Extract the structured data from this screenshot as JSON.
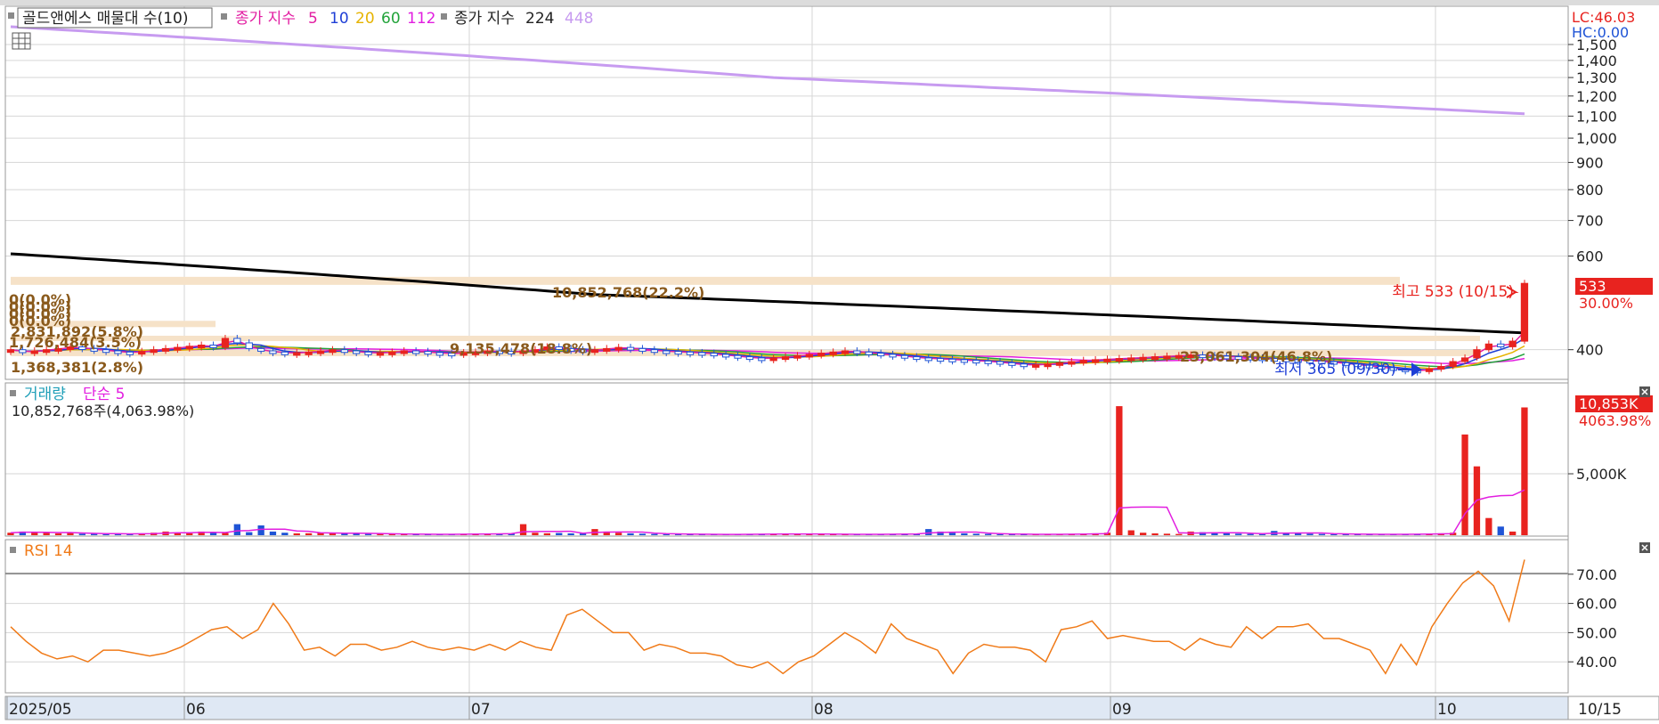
{
  "colors": {
    "up": "#e8231f",
    "down": "#1f54d6",
    "ma5": "#e21ea2",
    "ma10": "#1f3fd6",
    "ma20": "#e6b300",
    "ma60": "#22a33a",
    "ma112": "#e21ee0",
    "ma224": "#000000",
    "ma448": "#c79bf0",
    "vol_ma": "#e21ee0",
    "rsi": "#f07a18",
    "profile_text": "#8a5a1c",
    "profile_bar": "#f6e2c8",
    "grid": "#d6d6d6",
    "axis_bg": "#dfe8f4"
  },
  "legend": {
    "title": "골드앤에스 매물대 수(10)",
    "ma_label": "종가 지수",
    "ma_periods": [
      "5",
      "10",
      "20",
      "60",
      "112"
    ],
    "ma2_label": "종가 지수",
    "ma2_periods": [
      "224",
      "448"
    ],
    "volume_label": "거래량",
    "volume_ma_label": "단순 5",
    "volume_value": "10,852,768주(4,063.98%)",
    "rsi_label": "RSI 14"
  },
  "price_panel": {
    "lc": "LC:46.03",
    "hc": "HC:0.00",
    "high_label": "최고 533 (10/15)",
    "low_label": "최저 365 (09/30)",
    "last_price": "533",
    "last_change": "30.00%",
    "ticks": [
      "1,500",
      "1,400",
      "1,300",
      "1,200",
      "1,100",
      "1,000",
      "900",
      "800",
      "700",
      "600",
      "400"
    ],
    "profile_labels": [
      "10,852,768(22.2%)",
      "0(0.0%)",
      "0(0.0%)",
      "0(0.0%)",
      "0(0.0%)",
      "2,831,892(5.8%)",
      "1,726,484(3.5%)",
      "9,135,478(18.8%)",
      "23,061,304(46.8%)",
      "1,368,381(2.8%)"
    ]
  },
  "volume_panel": {
    "last_value": "10,853K",
    "last_pct": "4063.98%",
    "ticks": [
      "5,000K"
    ]
  },
  "rsi_panel": {
    "ticks": [
      "70.00",
      "60.00",
      "50.00",
      "40.00"
    ]
  },
  "x_axis": {
    "labels": [
      "2025/05",
      "06",
      "07",
      "08",
      "09",
      "10"
    ],
    "current": "10/15"
  },
  "chart_data": {
    "type": "line",
    "title": "골드앤에스 매물대 수(10)",
    "ylim": [
      360,
      1500
    ],
    "y_scale": "log",
    "price": [
      400,
      395,
      398,
      400,
      402,
      405,
      402,
      400,
      398,
      396,
      395,
      397,
      400,
      402,
      404,
      406,
      408,
      404,
      420,
      412,
      402,
      398,
      396,
      394,
      395,
      396,
      398,
      400,
      398,
      396,
      394,
      395,
      396,
      398,
      397,
      395,
      394,
      393,
      395,
      396,
      398,
      397,
      396,
      398,
      400,
      405,
      402,
      400,
      398,
      400,
      402,
      404,
      402,
      400,
      398,
      397,
      396,
      395,
      394,
      392,
      390,
      388,
      386,
      385,
      386,
      388,
      390,
      392,
      394,
      396,
      398,
      396,
      394,
      392,
      390,
      388,
      386,
      385,
      384,
      383,
      382,
      381,
      380,
      378,
      376,
      374,
      375,
      376,
      378,
      380,
      382,
      383,
      384,
      385,
      386,
      387,
      388,
      389,
      390,
      391,
      390,
      389,
      388,
      387,
      386,
      385,
      384,
      383,
      382,
      381,
      380,
      378,
      376,
      374,
      372,
      370,
      368,
      366,
      365,
      368,
      372,
      380,
      386,
      400,
      410,
      405,
      415,
      533
    ],
    "ma224": [
      606,
      604,
      602,
      600,
      598,
      596,
      594,
      592,
      590,
      588,
      586,
      584,
      582,
      580,
      578,
      576,
      574,
      572,
      570,
      568,
      566,
      564,
      562,
      560,
      558,
      556,
      554,
      552,
      550,
      548,
      546,
      544,
      542,
      540,
      538,
      536,
      534,
      532,
      530,
      528,
      526,
      524,
      522,
      520,
      518,
      516,
      514,
      512,
      510,
      508,
      507,
      506,
      505,
      504,
      503,
      502,
      501,
      500,
      499,
      498,
      497,
      496,
      495,
      494,
      493,
      492,
      491,
      490,
      489,
      488,
      487,
      486,
      485,
      484,
      483,
      482,
      481,
      480,
      479,
      478,
      477,
      476,
      475,
      474,
      473,
      472,
      471,
      470,
      469,
      468,
      467,
      466,
      465,
      464,
      463,
      462,
      461,
      460,
      459,
      458,
      457,
      456,
      455,
      454,
      453,
      452,
      451,
      450,
      449,
      448,
      447,
      446,
      445,
      444,
      443,
      442,
      441,
      440,
      439,
      438,
      437,
      436,
      435,
      434,
      433,
      432,
      431,
      430
    ],
    "ma448": [
      1620,
      1615,
      1610,
      1605,
      1600,
      1595,
      1590,
      1585,
      1580,
      1575,
      1570,
      1565,
      1560,
      1555,
      1550,
      1545,
      1540,
      1535,
      1530,
      1525,
      1520,
      1515,
      1510,
      1505,
      1500,
      1495,
      1490,
      1485,
      1480,
      1475,
      1470,
      1465,
      1460,
      1455,
      1450,
      1445,
      1440,
      1435,
      1430,
      1425,
      1420,
      1415,
      1410,
      1405,
      1400,
      1395,
      1390,
      1385,
      1380,
      1375,
      1370,
      1365,
      1360,
      1355,
      1350,
      1345,
      1340,
      1335,
      1330,
      1325,
      1320,
      1315,
      1310,
      1305,
      1300,
      1297,
      1294,
      1291,
      1288,
      1285,
      1282,
      1279,
      1276,
      1273,
      1270,
      1267,
      1264,
      1261,
      1258,
      1255,
      1252,
      1249,
      1246,
      1243,
      1240,
      1237,
      1234,
      1231,
      1228,
      1225,
      1222,
      1219,
      1216,
      1213,
      1210,
      1207,
      1204,
      1201,
      1198,
      1195,
      1192,
      1189,
      1186,
      1183,
      1180,
      1177,
      1174,
      1171,
      1168,
      1165,
      1162,
      1159,
      1156,
      1153,
      1150,
      1147,
      1144,
      1141,
      1138,
      1135,
      1132,
      1129,
      1126,
      1123,
      1120,
      1117,
      1114,
      1111
    ],
    "volume": [
      200,
      300,
      250,
      200,
      150,
      180,
      120,
      100,
      90,
      110,
      130,
      140,
      200,
      300,
      200,
      150,
      300,
      250,
      180,
      900,
      250,
      800,
      300,
      200,
      150,
      160,
      180,
      200,
      150,
      120,
      100,
      110,
      90,
      80,
      70,
      60,
      80,
      90,
      100,
      110,
      120,
      140,
      130,
      900,
      200,
      160,
      180,
      150,
      140,
      500,
      300,
      200,
      150,
      120,
      100,
      90,
      80,
      70,
      60,
      60,
      70,
      80,
      90,
      100,
      110,
      120,
      100,
      90,
      80,
      70,
      60,
      70,
      80,
      90,
      100,
      110,
      120,
      500,
      300,
      200,
      150,
      120,
      100,
      80,
      70,
      60,
      70,
      80,
      90,
      100,
      120,
      150,
      200,
      10500,
      400,
      200,
      150,
      120,
      100,
      300,
      250,
      200,
      150,
      120,
      100,
      90,
      350,
      200,
      150,
      120,
      100,
      90,
      80,
      70,
      60,
      70,
      80,
      90,
      100,
      120,
      150,
      200,
      8200,
      5600,
      1400,
      700,
      300,
      10400
    ],
    "rsi": [
      52,
      47,
      43,
      41,
      42,
      40,
      44,
      44,
      43,
      42,
      43,
      45,
      48,
      51,
      52,
      48,
      51,
      60,
      53,
      44,
      45,
      42,
      46,
      46,
      44,
      45,
      47,
      45,
      44,
      45,
      44,
      46,
      44,
      47,
      45,
      44,
      56,
      58,
      54,
      50,
      50,
      44,
      46,
      45,
      43,
      43,
      42,
      39,
      38,
      40,
      36,
      40,
      42,
      46,
      50,
      47,
      43,
      53,
      48,
      46,
      44,
      36,
      43,
      46,
      45,
      45,
      44,
      40,
      51,
      52,
      54,
      48,
      49,
      48,
      47,
      47,
      44,
      48,
      46,
      45,
      52,
      48,
      52,
      52,
      53,
      48,
      48,
      46,
      44,
      36,
      46,
      39,
      52,
      60,
      67,
      71,
      66,
      54,
      75
    ],
    "rsi_ylim": [
      30,
      80
    ]
  }
}
